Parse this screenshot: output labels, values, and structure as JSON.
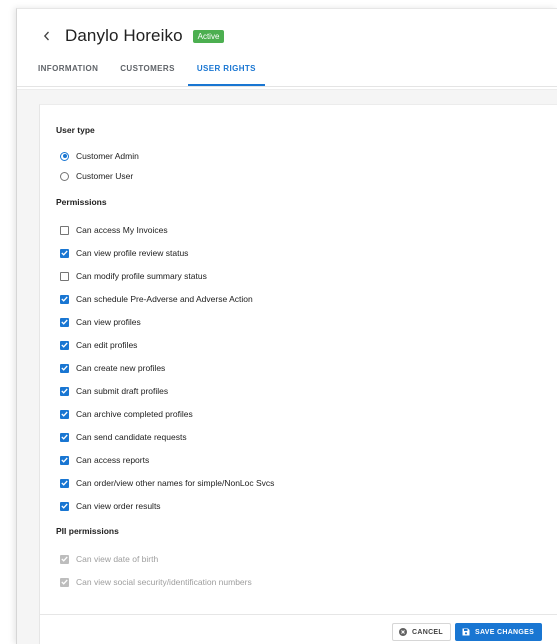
{
  "header": {
    "back_icon": "chevron-left-icon",
    "title": "Danylo Horeiko",
    "status": "Active",
    "status_color": "#4caf50"
  },
  "tabs": [
    {
      "label": "INFORMATION",
      "active": false
    },
    {
      "label": "CUSTOMERS",
      "active": false
    },
    {
      "label": "USER RIGHTS",
      "active": true
    }
  ],
  "accent_color": "#1976d2",
  "user_type": {
    "title": "User type",
    "options": [
      {
        "label": "Customer Admin",
        "selected": true
      },
      {
        "label": "Customer User",
        "selected": false
      }
    ]
  },
  "permissions": {
    "title": "Permissions",
    "items": [
      {
        "label": "Can access My Invoices",
        "checked": false
      },
      {
        "label": "Can view profile review status",
        "checked": true
      },
      {
        "label": "Can modify profile summary status",
        "checked": false
      },
      {
        "label": "Can schedule Pre-Adverse and Adverse Action",
        "checked": true
      },
      {
        "label": "Can view profiles",
        "checked": true
      },
      {
        "label": "Can edit profiles",
        "checked": true
      },
      {
        "label": "Can create new profiles",
        "checked": true
      },
      {
        "label": "Can submit draft profiles",
        "checked": true
      },
      {
        "label": "Can archive completed profiles",
        "checked": true
      },
      {
        "label": "Can send candidate requests",
        "checked": true
      },
      {
        "label": "Can access reports",
        "checked": true
      },
      {
        "label": "Can order/view other names for simple/NonLoc Svcs",
        "checked": true
      },
      {
        "label": "Can view order results",
        "checked": true
      }
    ]
  },
  "pii_permissions": {
    "title": "PII permissions",
    "items": [
      {
        "label": "Can view date of birth",
        "checked": true,
        "disabled": true
      },
      {
        "label": "Can view social security/identification numbers",
        "checked": true,
        "disabled": true
      }
    ]
  },
  "actions": {
    "cancel_label": "CANCEL",
    "cancel_icon": "cancel-circle-icon",
    "save_label": "SAVE CHANGES",
    "save_icon": "save-icon"
  }
}
